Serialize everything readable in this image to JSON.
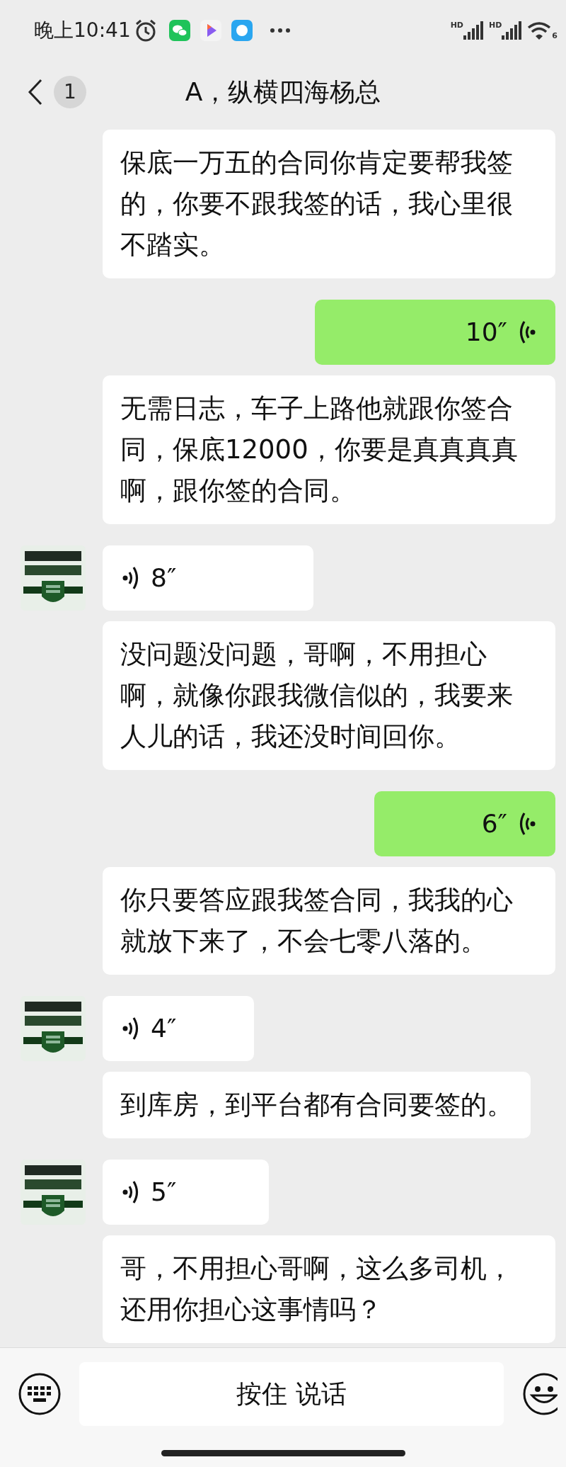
{
  "status_bar": {
    "time": "晚上10:41",
    "signals": [
      {
        "label": "HD"
      },
      {
        "label": "HD"
      }
    ],
    "wifi_label": "6"
  },
  "header": {
    "unread": "1",
    "title": "A，纵横四海杨总"
  },
  "messages": [
    {
      "kind": "text",
      "outgoing": false,
      "avatar": false,
      "text": "保底一万五的合同你肯定要帮我签的，你要不跟我签的话，我心里很不踏实。"
    },
    {
      "kind": "voice",
      "outgoing": true,
      "avatar": false,
      "duration": "10″"
    },
    {
      "kind": "text",
      "outgoing": false,
      "avatar": false,
      "text": "无需日志，车子上路他就跟你签合同，保底12000，你要是真真真真啊，跟你签的合同。"
    },
    {
      "kind": "voice",
      "outgoing": false,
      "avatar": true,
      "duration": "8″"
    },
    {
      "kind": "text",
      "outgoing": false,
      "avatar": false,
      "text": "没问题没问题，哥啊，不用担心啊，就像你跟我微信似的，我要来人儿的话，我还没时间回你。"
    },
    {
      "kind": "voice",
      "outgoing": true,
      "avatar": false,
      "duration": "6″"
    },
    {
      "kind": "text",
      "outgoing": false,
      "avatar": false,
      "text": "你只要答应跟我签合同，我我的心就放下来了，不会七零八落的。"
    },
    {
      "kind": "voice",
      "outgoing": false,
      "avatar": true,
      "duration": "4″"
    },
    {
      "kind": "text",
      "outgoing": false,
      "avatar": false,
      "text": "到库房，到平台都有合同要签的。"
    },
    {
      "kind": "voice",
      "outgoing": false,
      "avatar": true,
      "duration": "5″"
    },
    {
      "kind": "text",
      "outgoing": false,
      "avatar": false,
      "text": "哥，不用担心哥啊，这么多司机，还用你担心这事情吗？"
    }
  ],
  "input_bar": {
    "hold_to_talk": "按住 说话"
  }
}
